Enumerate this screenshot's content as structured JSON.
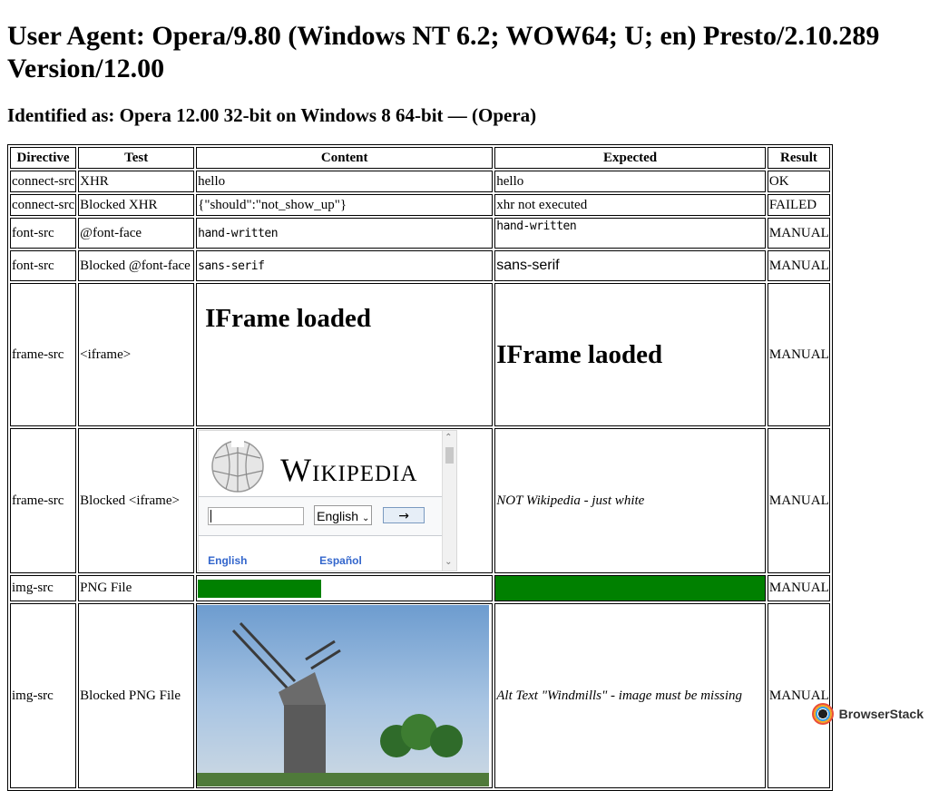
{
  "header": {
    "user_agent": "User Agent: Opera/9.80 (Windows NT 6.2; WOW64; U; en) Presto/2.10.289 Version/12.00",
    "identified": "Identified as: Opera 12.00 32-bit on Windows 8 64-bit — (Opera)"
  },
  "table": {
    "headers": [
      "Directive",
      "Test",
      "Content",
      "Expected",
      "Result"
    ],
    "rows": [
      {
        "directive": "connect-src",
        "test": "XHR",
        "content": "hello",
        "expected": "hello",
        "result": "OK"
      },
      {
        "directive": "connect-src",
        "test": "Blocked XHR",
        "content": "{\"should\":\"not_show_up\"}",
        "expected": "xhr not executed",
        "result": "FAILED"
      },
      {
        "directive": "font-src",
        "test": "@font-face",
        "content": "hand-written",
        "expected": "hand-written",
        "result": "MANUAL"
      },
      {
        "directive": "font-src",
        "test": "Blocked @font-face",
        "content": "sans-serif",
        "expected": "sans-serif",
        "result": "MANUAL"
      },
      {
        "directive": "frame-src",
        "test": "<iframe>",
        "content": "IFrame loaded",
        "expected": "IFrame laoded",
        "result": "MANUAL"
      },
      {
        "directive": "frame-src",
        "test": "Blocked <iframe>",
        "content": "",
        "expected": "NOT Wikipedia - just white",
        "result": "MANUAL"
      },
      {
        "directive": "img-src",
        "test": "PNG File",
        "content": "",
        "expected": "",
        "result": "MANUAL"
      },
      {
        "directive": "img-src",
        "test": "Blocked PNG File",
        "content": "",
        "expected": "Alt Text \"Windmills\" - image must be missing",
        "result": "MANUAL"
      }
    ]
  },
  "wikipedia": {
    "wordmark": "Wikipedia",
    "select_value": "English",
    "go_label": "→",
    "link_english": "English",
    "link_espanol": "Español"
  },
  "img_png_fraction": 0.42,
  "colors": {
    "green": "#008000",
    "link": "#3366cc"
  },
  "footer": {
    "brand": "BrowserStack"
  }
}
